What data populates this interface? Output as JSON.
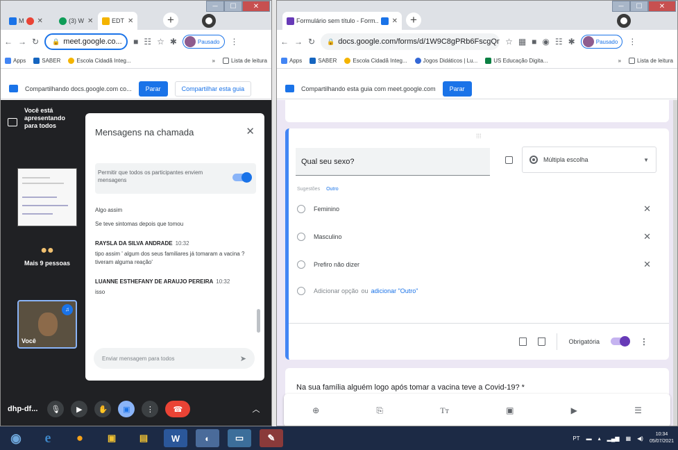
{
  "left_window": {
    "tabs": [
      {
        "label": "M",
        "color": "#ea4335"
      },
      {
        "label": "(3) W",
        "color": "#0f9d58"
      },
      {
        "label": "EDT",
        "color": "#f4b400"
      }
    ],
    "url": "meet.google.co...",
    "profile_status": "Pausado",
    "bookmarks": [
      "Apps",
      "SABER",
      "Escola Cidadã Integ...",
      "»",
      "Lista de leitura"
    ],
    "share_banner": {
      "text": "Compartilhando docs.google.com co...",
      "stop": "Parar",
      "share_tab": "Compartilhar esta guia"
    },
    "meet": {
      "presenting": "Você está apresentando para todos",
      "more_people": "Mais 9 pessoas",
      "self_label": "Você",
      "meeting_code": "dhp-df...",
      "chat": {
        "title": "Mensagens na chamada",
        "allow_text": "Permitir que todos os participantes enviem mensagens",
        "messages": [
          {
            "sender": "",
            "time": "",
            "text": "Algo assim"
          },
          {
            "sender": "",
            "time": "",
            "text": "Se teve sintomas depois que tomou"
          },
          {
            "sender": "RAYSLA DA SILVA ANDRADE",
            "time": "10:32",
            "text": "tipo assim ' algum dos seus familiares já tomaram a vacina ? tiveram alguma reação'"
          },
          {
            "sender": "LUANNE ESTHEFANY DE ARAUJO PEREIRA",
            "time": "10:32",
            "text": "isso"
          }
        ],
        "input_placeholder": "Enviar mensagem para todos"
      }
    }
  },
  "right_window": {
    "tab_title": "Formulário sem título - Form...",
    "url": "docs.google.com/forms/d/1W9C8gPRb6FscgQnw...",
    "profile_status": "Pausado",
    "bookmarks": [
      "Apps",
      "SABER",
      "Escola Cidadã Integ...",
      "Jogos Didáticos | Lu...",
      "US Educação Digita...",
      "»",
      "Lista de leitura"
    ],
    "share_banner": {
      "text": "Compartilhando esta guia com meet.google.com",
      "stop": "Parar"
    },
    "question": {
      "title": "Qual seu sexo?",
      "type": "Múltipla escolha",
      "suggestions_label": "Sugestões",
      "suggestion": "Outro",
      "options": [
        "Feminino",
        "Masculino",
        "Prefiro não dizer"
      ],
      "add_option": "Adicionar opção",
      "add_or": "ou",
      "add_other": "adicionar \"Outro\"",
      "required_label": "Obrigatória"
    },
    "next_question": "Na sua família alguém logo após tomar a vacina teve a Covid-19? *"
  },
  "taskbar": {
    "lang": "PT",
    "time": "10:34",
    "date": "05/07/2021"
  }
}
